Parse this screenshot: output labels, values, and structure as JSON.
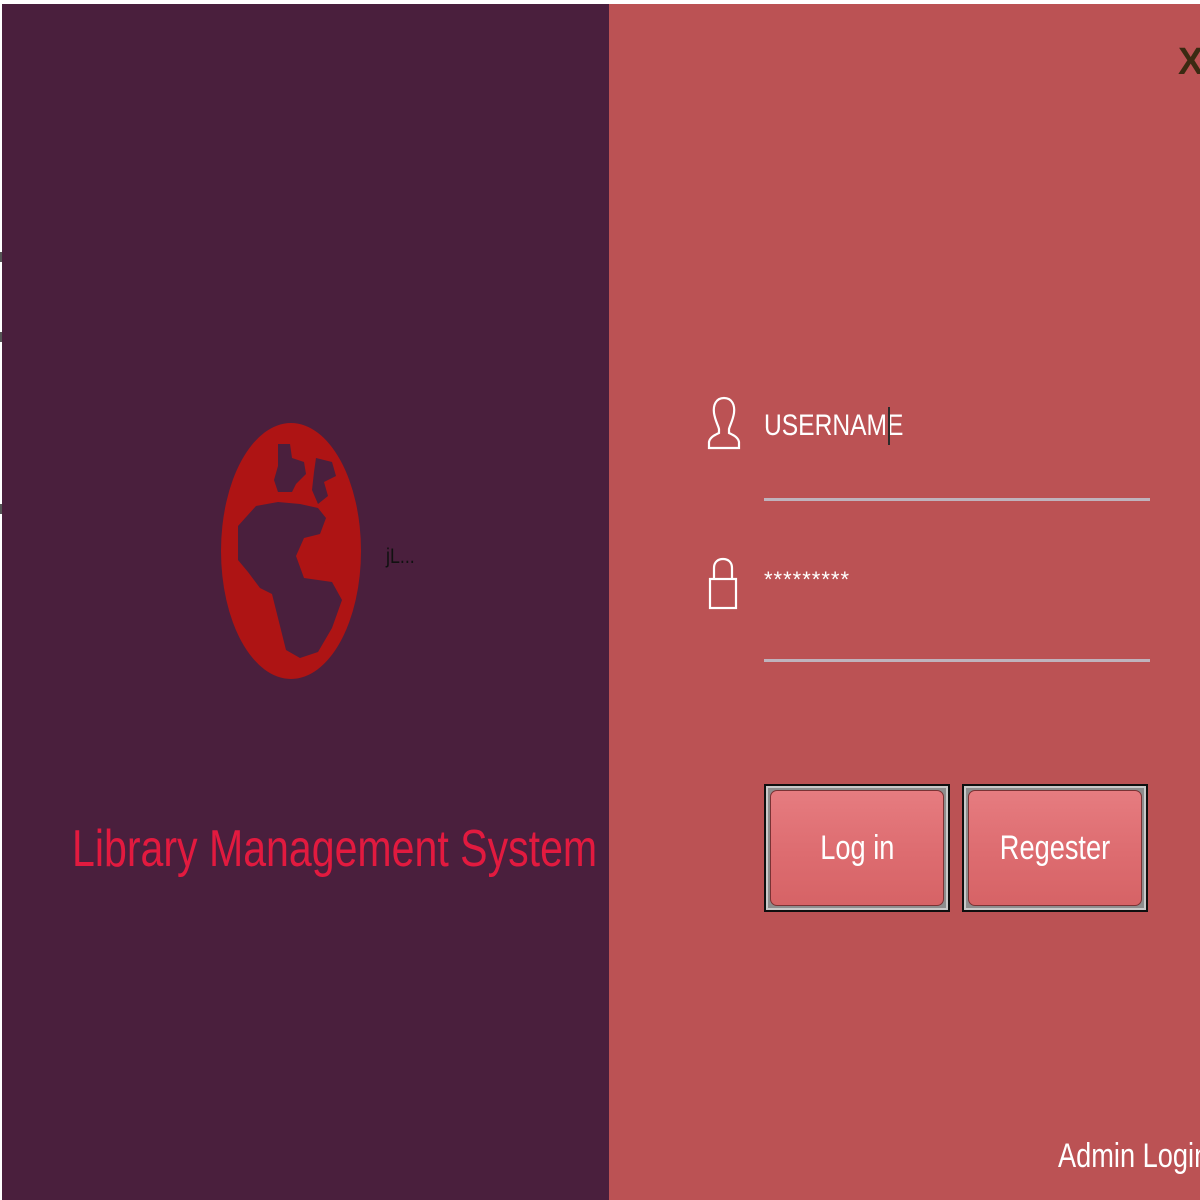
{
  "window": {
    "close_label": "X"
  },
  "branding": {
    "logo_icon": "globe-icon",
    "logo_caption": "jL...",
    "app_title": "Library Management System"
  },
  "login_form": {
    "username": {
      "icon": "user-icon",
      "value": "USERNAME"
    },
    "password": {
      "icon": "lock-icon",
      "value": "*********"
    },
    "login_button": "Log in",
    "register_button": "Regester",
    "admin_link": "Admin Login"
  },
  "colors": {
    "left_panel": "#4a1f3d",
    "right_panel": "#bb5254",
    "title": "#e21a3f",
    "globe": "#ae1414",
    "button": "#dd6c70"
  }
}
